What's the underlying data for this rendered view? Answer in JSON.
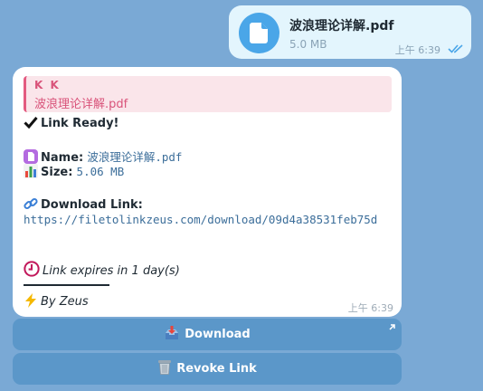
{
  "outgoing": {
    "file_name": "波浪理论详解.pdf",
    "file_size": "5.0 MB",
    "time": "上午 6:39"
  },
  "incoming": {
    "reply": {
      "sender": "K K",
      "text": "波浪理论详解.pdf"
    },
    "status": "Link Ready!",
    "name_label": "Name:",
    "name_value": "波浪理论详解.pdf",
    "size_label": "Size:",
    "size_value": "5.06 MB",
    "download_label": "Download Link:",
    "download_url": "https://filetolinkzeus.com/download/09d4a38531feb75d",
    "expires": "Link expires in 1 day(s)",
    "signature": "By Zeus",
    "time": "上午 6:39"
  },
  "buttons": {
    "download": "Download",
    "revoke": "Revoke Link"
  },
  "colors": {
    "background": "#7aa9d5",
    "outgoing_bubble": "#e3f5fd",
    "reply_accent": "#d9537a",
    "link": "#3c6e9a",
    "button": "#5b97c9"
  },
  "icons": {
    "file": "file-icon",
    "read_receipt": "double-check-icon",
    "check": "check-mark-icon",
    "name": "document-icon",
    "size": "bar-chart-icon",
    "link": "link-icon",
    "clock": "clock-icon",
    "zap": "lightning-icon",
    "inbox": "inbox-tray-icon",
    "trash": "wastebasket-icon",
    "external": "external-arrow-icon"
  }
}
